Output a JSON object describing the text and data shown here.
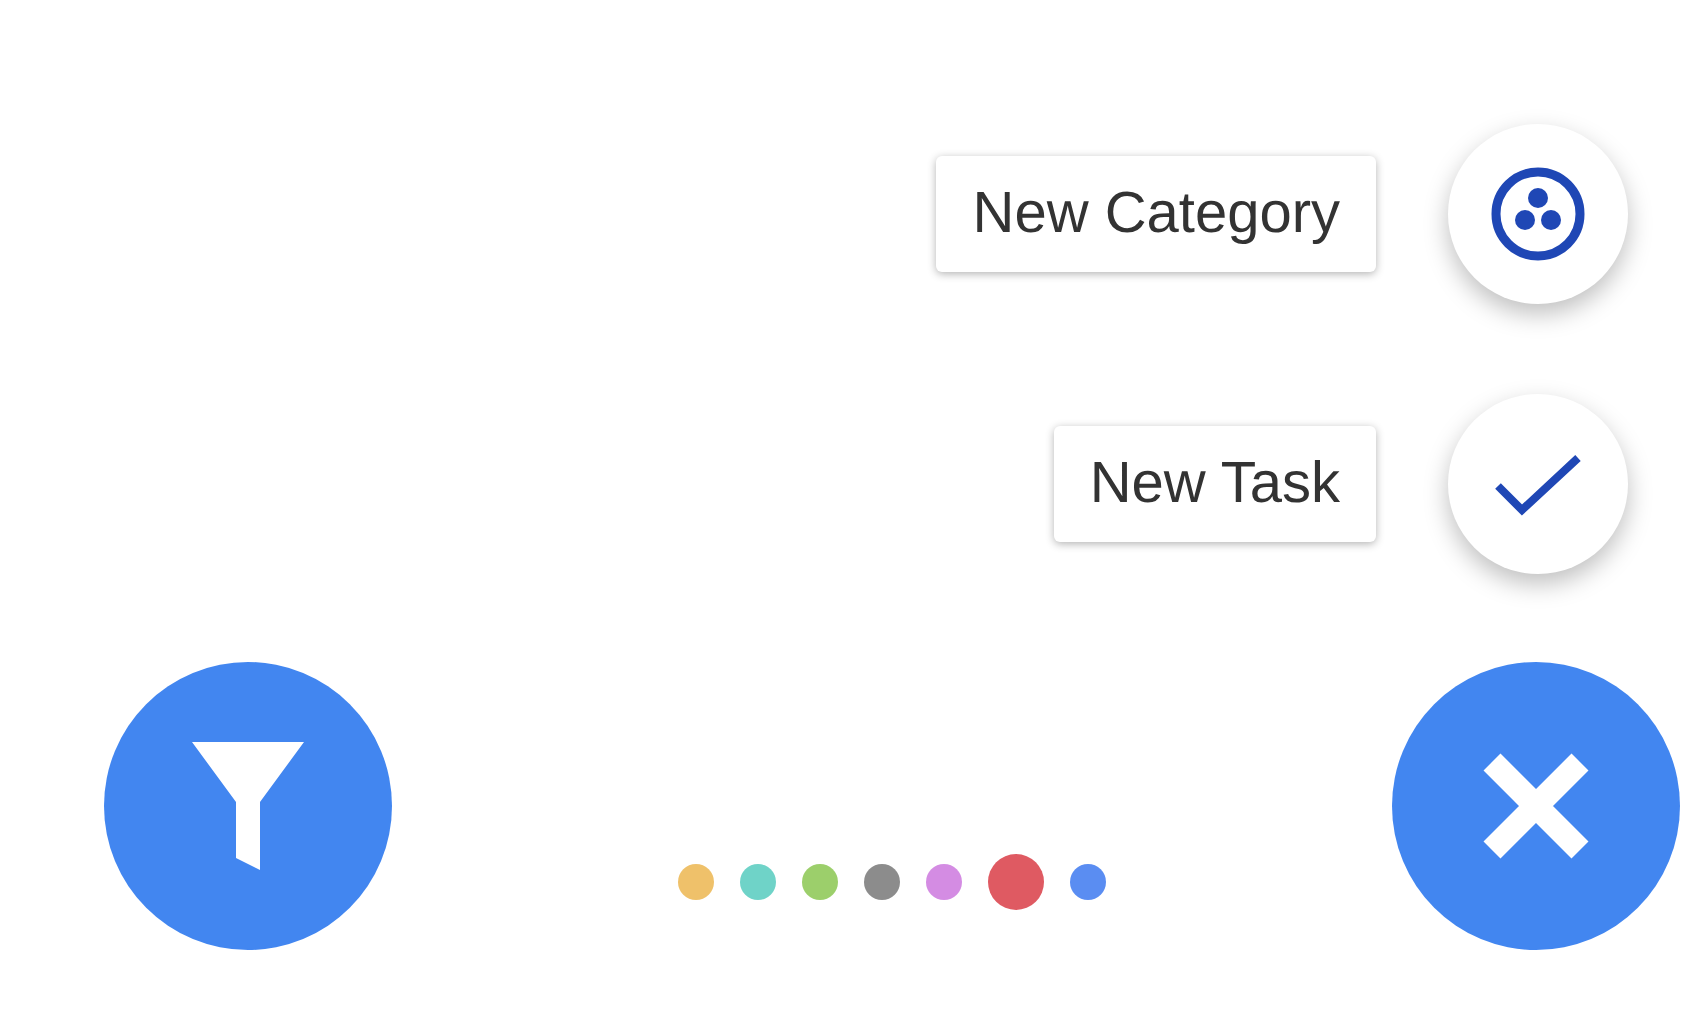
{
  "actions": [
    {
      "label": "New Category",
      "kind": "category"
    },
    {
      "label": "New Task",
      "kind": "task"
    }
  ],
  "filter_button": {
    "kind": "filter"
  },
  "color_dots": [
    {
      "color": "#efc16a",
      "selected": false
    },
    {
      "color": "#6fd3c8",
      "selected": false
    },
    {
      "color": "#9ccf6b",
      "selected": false
    },
    {
      "color": "#8c8c8c",
      "selected": false
    },
    {
      "color": "#d48ce3",
      "selected": false
    },
    {
      "color": "#df5a62",
      "selected": true
    },
    {
      "color": "#5a8df2",
      "selected": false
    }
  ],
  "main_button": {
    "expanded": true
  }
}
